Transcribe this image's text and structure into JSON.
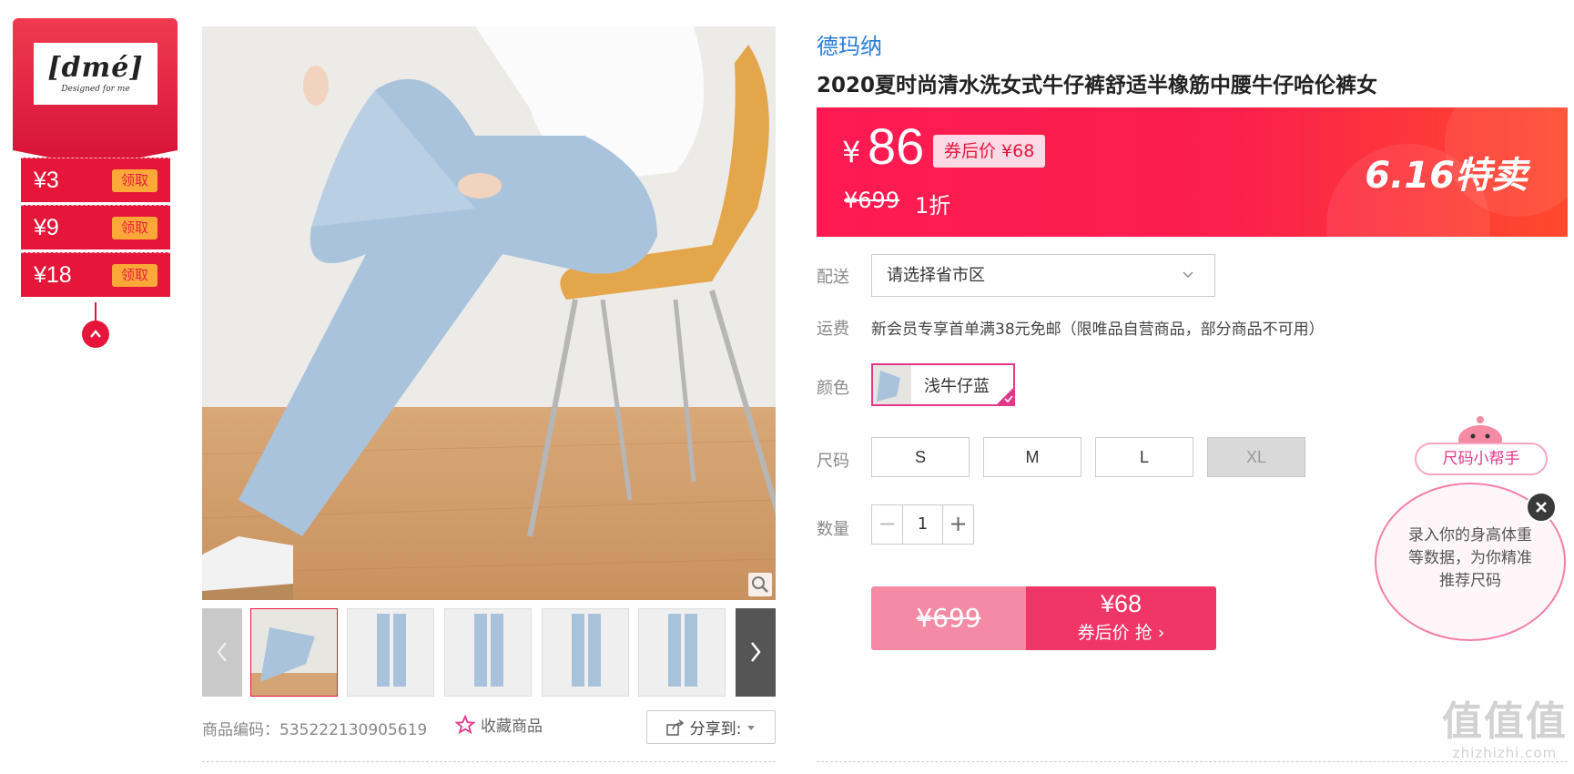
{
  "brand_logo": {
    "text": "[dmé]",
    "tagline": "Designed for me"
  },
  "coupons": [
    {
      "amount": "¥3",
      "action": "领取"
    },
    {
      "amount": "¥9",
      "action": "领取"
    },
    {
      "amount": "¥18",
      "action": "领取"
    }
  ],
  "gallery": {
    "thumbnail_count": 5,
    "product_code_label": "商品编码：535222130905619",
    "favorite_label": "收藏商品",
    "share_label": "分享到:"
  },
  "product": {
    "brand": "德玛纳",
    "title": "2020夏时尚清水洗女式牛仔裤舒适半橡筋中腰牛仔哈伦裤女"
  },
  "price": {
    "currency": "¥",
    "current": "86",
    "coupon_price": "券后价 ¥68",
    "original": "¥699",
    "discount": "1折",
    "promo": "6.16特卖"
  },
  "options": {
    "delivery_label": "配送",
    "delivery_placeholder": "请选择省市区",
    "shipping_label": "运费",
    "shipping_text": "新会员专享首单满38元免邮（限唯品自营商品，部分商品不可用）",
    "color_label": "颜色",
    "color_selected": "浅牛仔蓝",
    "size_label": "尺码",
    "sizes": [
      "S",
      "M",
      "L",
      "XL"
    ],
    "quantity_label": "数量",
    "quantity": "1",
    "minus": "−",
    "plus": "+"
  },
  "buy": {
    "original": "¥699",
    "price": "¥68",
    "cta": "券后价 抢 ›"
  },
  "size_helper": {
    "button": "尺码小帮手",
    "tip": "录入你的身高体重等数据，为你精准推荐尺码"
  },
  "watermark": {
    "big": "值值值",
    "small": "zhizhizhi.com"
  },
  "colors": {
    "accent": "#e5163a",
    "pink": "#ef3667",
    "brand_blue": "#2b7cd6"
  }
}
